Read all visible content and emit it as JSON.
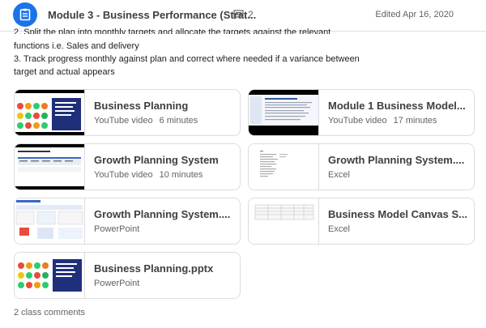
{
  "header": {
    "title": "Module 3 - Business Performance (Strat...",
    "comment_count": "2",
    "edited": "Edited Apr 16, 2020"
  },
  "description": {
    "partial_line": "2. Split the plan into monthly targets and allocate the targets against the relevant",
    "lines": [
      "functions i.e. Sales and delivery",
      "3. Track progress monthly against plan and correct where needed if a variance between",
      "target and actual appears"
    ]
  },
  "attachments": [
    {
      "title": "Business Planning",
      "type": "YouTube video",
      "duration": "6 minutes",
      "thumb": "video-gauges-thumbnail"
    },
    {
      "title": "Module 1 Business Model...",
      "type": "YouTube video",
      "duration": "17 minutes",
      "thumb": "video-document-thumbnail"
    },
    {
      "title": "Growth Planning System",
      "type": "YouTube video",
      "duration": "10 minutes",
      "thumb": "video-slide-thumbnail"
    },
    {
      "title": "Growth Planning System....",
      "type": "Excel",
      "duration": "",
      "thumb": "spreadsheet-thumbnail"
    },
    {
      "title": "Growth Planning System....",
      "type": "PowerPoint",
      "duration": "",
      "thumb": "slide-thumbnail"
    },
    {
      "title": "Business Model Canvas S...",
      "type": "Excel",
      "duration": "",
      "thumb": "spreadsheet-table-thumbnail"
    },
    {
      "title": "Business Planning.pptx",
      "type": "PowerPoint",
      "duration": "",
      "thumb": "slide-gauges-thumbnail"
    }
  ],
  "comments_link": "2 class comments",
  "colors": {
    "accent": "#1a73e8",
    "border": "#dadce0",
    "muted": "#5f6368"
  }
}
